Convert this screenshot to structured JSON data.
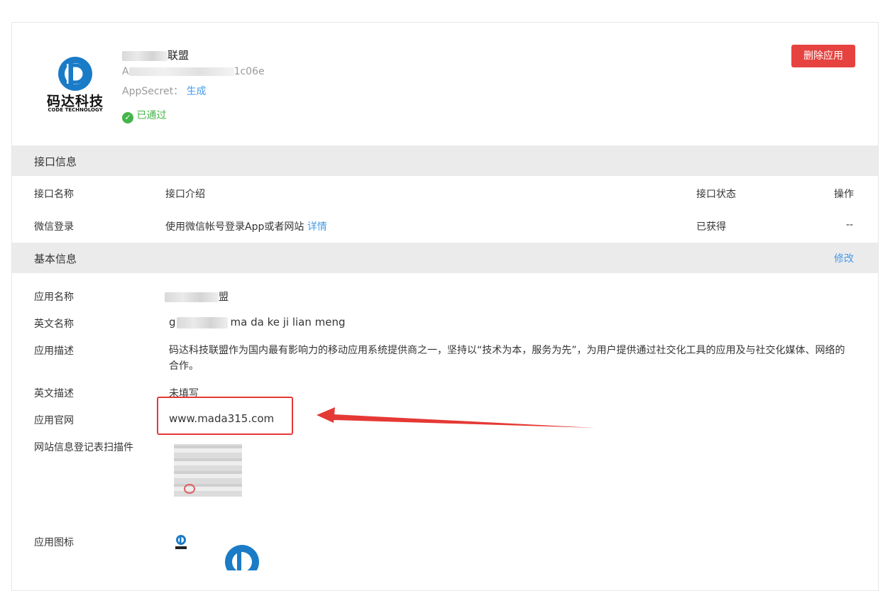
{
  "app": {
    "name_suffix": "联盟",
    "appid_prefix": "A",
    "appid_suffix": "1c06e",
    "appsecret_label": "AppSecret：",
    "appsecret_action": "生成",
    "status": "已通过",
    "delete_button": "删除应用",
    "logo_text": "码达科技",
    "logo_subtext": "CODE TECHNOLOGY"
  },
  "interface_section": {
    "title": "接口信息",
    "headers": {
      "name": "接口名称",
      "intro": "接口介绍",
      "status": "接口状态",
      "action": "操作"
    },
    "rows": [
      {
        "name": "微信登录",
        "intro": "使用微信帐号登录App或者网站",
        "detail_link": "详情",
        "status": "已获得",
        "action": "--"
      }
    ]
  },
  "basic_section": {
    "title": "基本信息",
    "edit_link": "修改",
    "fields": {
      "app_name_label": "应用名称",
      "app_name_suffix": "盟",
      "en_name_label": "英文名称",
      "en_name_prefix": "g",
      "en_name_suffix": "ma da ke ji lian meng",
      "desc_label": "应用描述",
      "desc_value": "码达科技联盟作为国内最有影响力的移动应用系统提供商之一，坚持以“技术为本，服务为先”，为用户提供通过社交化工具的应用及与社交化媒体、网络的合作。",
      "en_desc_label": "英文描述",
      "en_desc_value": "未填写",
      "website_label": "应用官网",
      "website_value": "www.mada315.com",
      "scan_label": "网站信息登记表扫描件",
      "icon_label": "应用图标"
    }
  },
  "colors": {
    "accent_link": "#459ae9",
    "danger": "#e64340",
    "success": "#44b549",
    "section_bg": "#ebebeb",
    "annotation_red": "#e53935"
  }
}
